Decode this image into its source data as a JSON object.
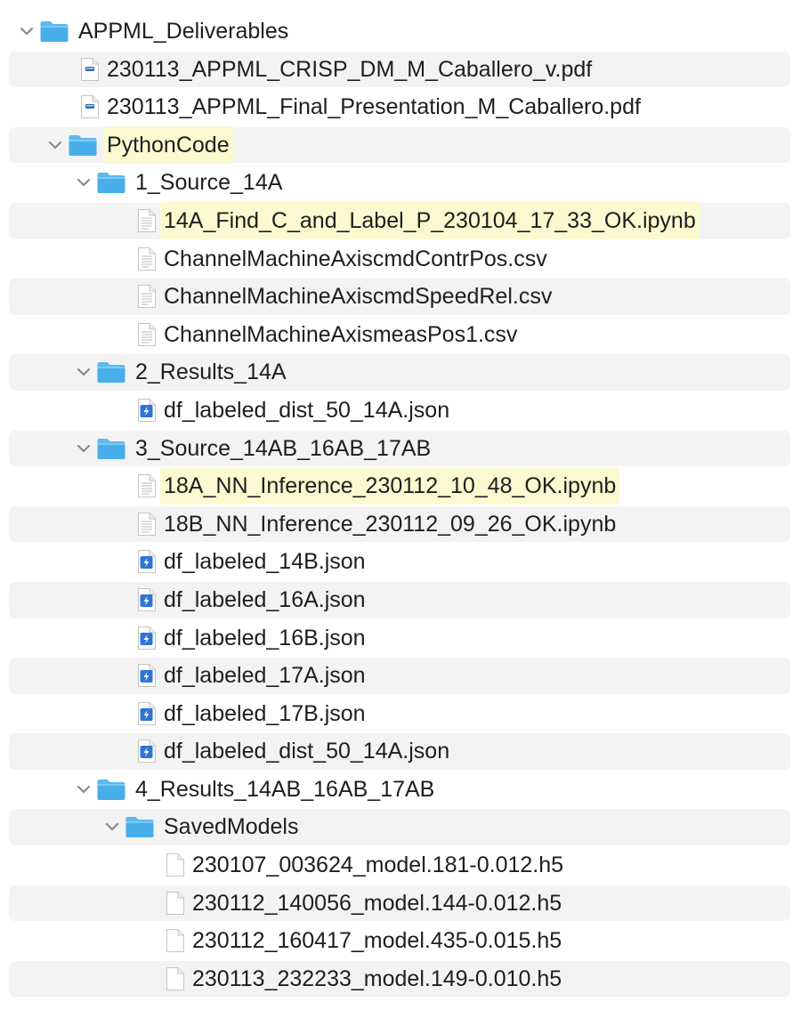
{
  "colors": {
    "stripe": "#f3f3f3",
    "highlight": "#fbf9d0",
    "folder": "#4fb3ef",
    "text": "#1e1e1e"
  },
  "tree": [
    {
      "label": "APPML_Deliverables",
      "kind": "folder",
      "depth": 0,
      "expanded": true
    },
    {
      "label": "230113_APPML_CRISP_DM_M_Caballero_v.pdf",
      "kind": "pdf",
      "depth": 1
    },
    {
      "label": "230113_APPML_Final_Presentation_M_Caballero.pdf",
      "kind": "pdf",
      "depth": 1
    },
    {
      "label": "PythonCode",
      "kind": "folder",
      "depth": 1,
      "expanded": true,
      "highlighted": true
    },
    {
      "label": "1_Source_14A",
      "kind": "folder",
      "depth": 2,
      "expanded": true
    },
    {
      "label": "14A_Find_C_and_Label_P_230104_17_33_OK.ipynb",
      "kind": "text",
      "depth": 3,
      "highlighted": true
    },
    {
      "label": "ChannelMachineAxiscmdContrPos.csv",
      "kind": "text",
      "depth": 3
    },
    {
      "label": "ChannelMachineAxiscmdSpeedRel.csv",
      "kind": "text",
      "depth": 3
    },
    {
      "label": "ChannelMachineAxismeasPos1.csv",
      "kind": "text",
      "depth": 3
    },
    {
      "label": "2_Results_14A",
      "kind": "folder",
      "depth": 2,
      "expanded": true
    },
    {
      "label": "df_labeled_dist_50_14A.json",
      "kind": "json",
      "depth": 3
    },
    {
      "label": "3_Source_14AB_16AB_17AB",
      "kind": "folder",
      "depth": 2,
      "expanded": true
    },
    {
      "label": "18A_NN_Inference_230112_10_48_OK.ipynb",
      "kind": "text",
      "depth": 3,
      "highlighted": true
    },
    {
      "label": "18B_NN_Inference_230112_09_26_OK.ipynb",
      "kind": "text",
      "depth": 3
    },
    {
      "label": "df_labeled_14B.json",
      "kind": "json",
      "depth": 3
    },
    {
      "label": "df_labeled_16A.json",
      "kind": "json",
      "depth": 3
    },
    {
      "label": "df_labeled_16B.json",
      "kind": "json",
      "depth": 3
    },
    {
      "label": "df_labeled_17A.json",
      "kind": "json",
      "depth": 3
    },
    {
      "label": "df_labeled_17B.json",
      "kind": "json",
      "depth": 3
    },
    {
      "label": "df_labeled_dist_50_14A.json",
      "kind": "json",
      "depth": 3
    },
    {
      "label": "4_Results_14AB_16AB_17AB",
      "kind": "folder",
      "depth": 2,
      "expanded": true
    },
    {
      "label": "SavedModels",
      "kind": "folder",
      "depth": 3,
      "expanded": true
    },
    {
      "label": "230107_003624_model.181-0.012.h5",
      "kind": "blank",
      "depth": 4
    },
    {
      "label": "230112_140056_model.144-0.012.h5",
      "kind": "blank",
      "depth": 4
    },
    {
      "label": "230112_160417_model.435-0.015.h5",
      "kind": "blank",
      "depth": 4
    },
    {
      "label": "230113_232233_model.149-0.010.h5",
      "kind": "blank",
      "depth": 4
    }
  ]
}
